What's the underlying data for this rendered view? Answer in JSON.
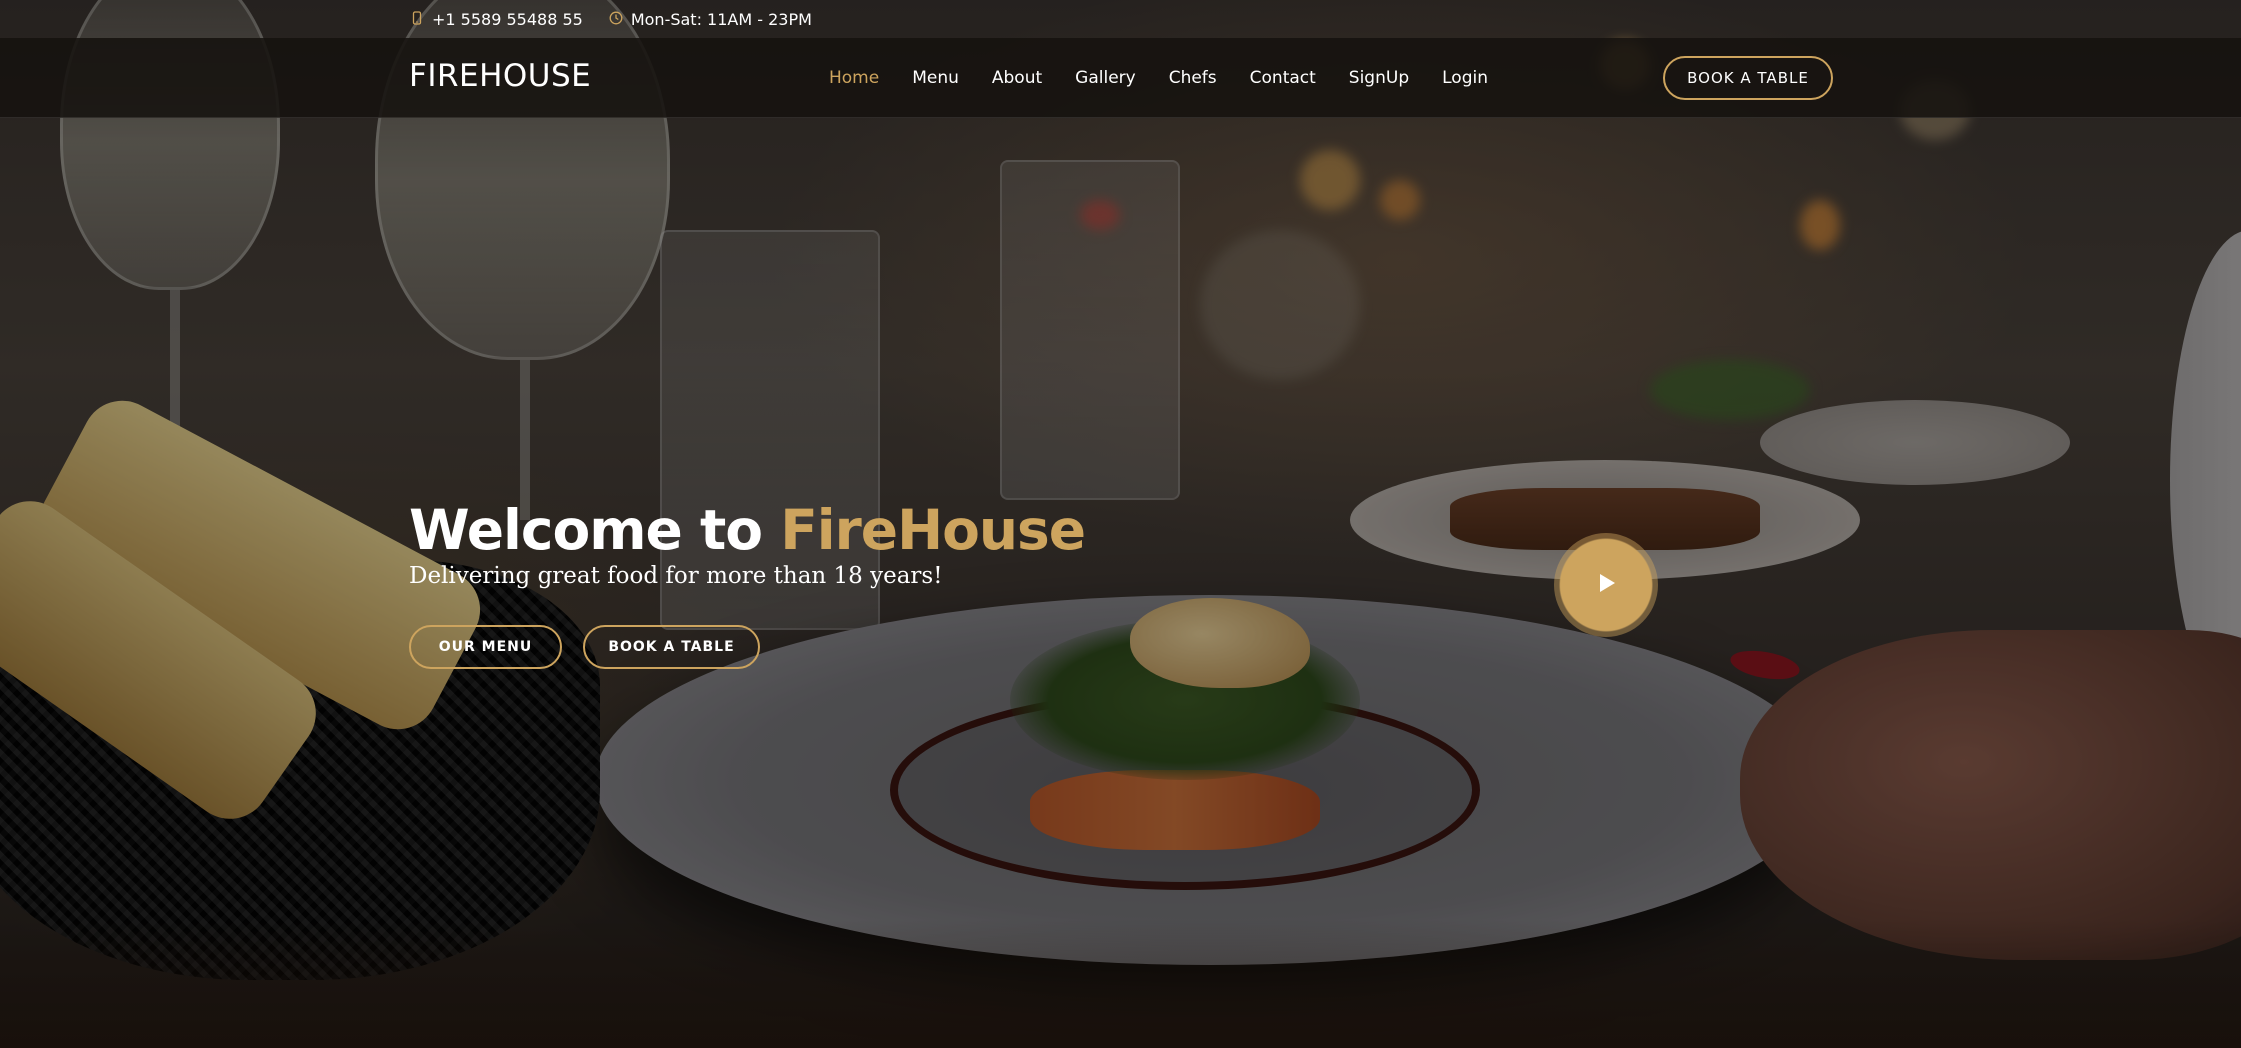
{
  "topbar": {
    "phone_icon": "phone-icon",
    "phone": "+1 5589 55488 55",
    "hours_icon": "clock-icon",
    "hours": "Mon-Sat: 11AM - 23PM"
  },
  "header": {
    "logo": "FIREHOUSE",
    "nav": [
      "Home",
      "Menu",
      "About",
      "Gallery",
      "Chefs",
      "Contact",
      "SignUp",
      "Login"
    ],
    "active_nav": "Home",
    "book_button": "BOOK A TABLE"
  },
  "hero": {
    "title_prefix": "Welcome to ",
    "title_brand": "FireHouse",
    "subtitle": "Delivering great food for more than 18 years!",
    "menu_button": "OUR MENU",
    "book_button": "BOOK A TABLE",
    "play_icon": "play-icon"
  },
  "colors": {
    "accent": "#cda45e",
    "header_bg": "#16120f",
    "text": "#ffffff"
  }
}
